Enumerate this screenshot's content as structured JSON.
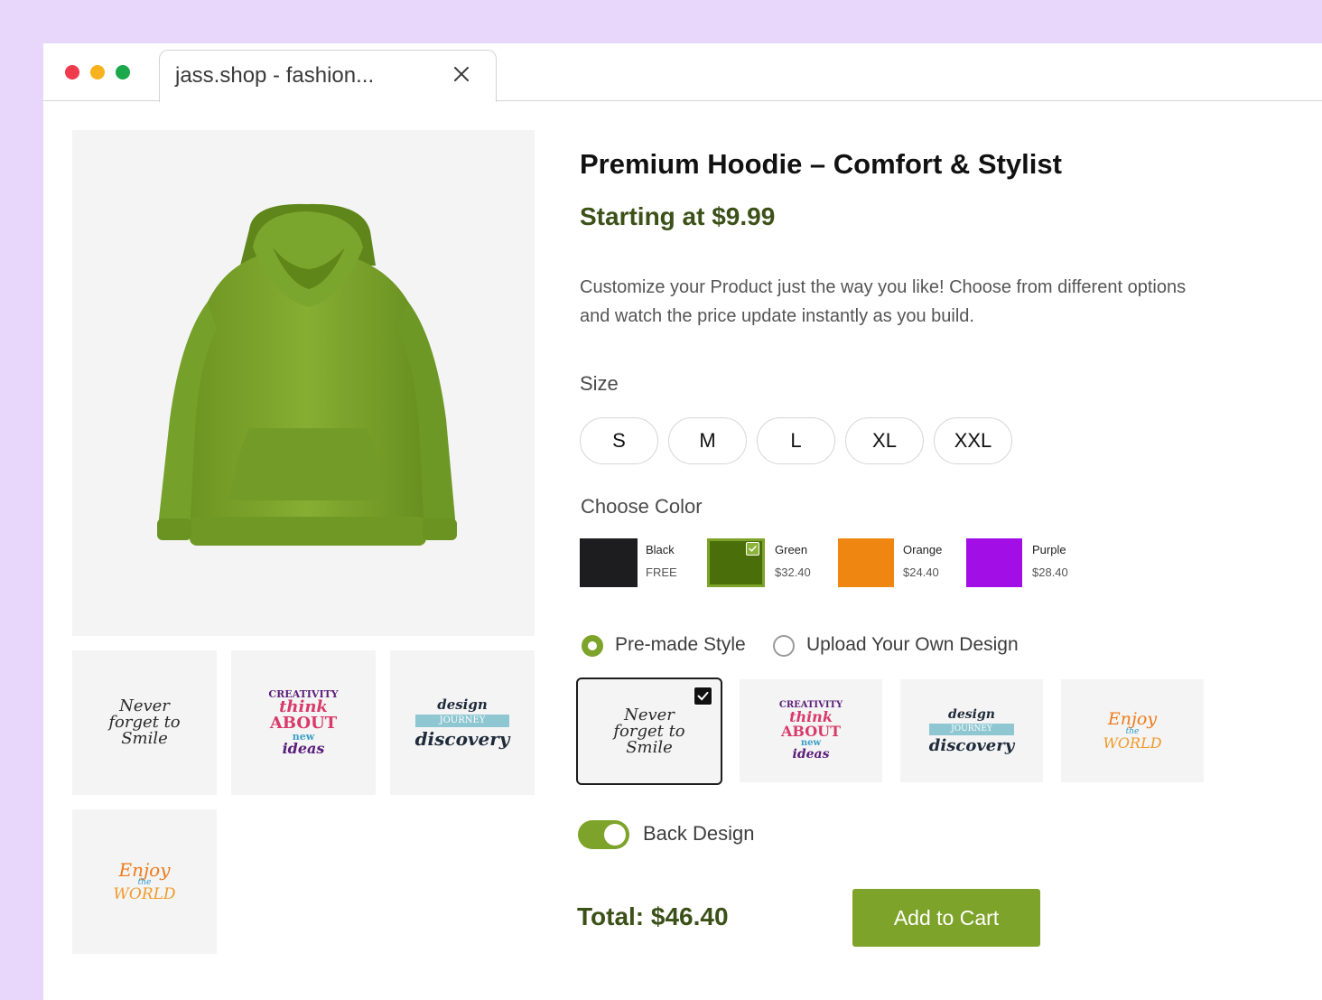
{
  "browser": {
    "tab_title": "jass.shop - fashion...",
    "icons": {
      "close": "close-icon"
    },
    "window_dots": [
      "#ef3b4c",
      "#f7b21e",
      "#1aa84a"
    ]
  },
  "product": {
    "title": "Premium Hoodie – Comfort & Stylist",
    "price": "Starting at $9.99",
    "description": "Customize your Product just the way you like! Choose from different options and watch the price update instantly as you build.",
    "image_color": "#7fa62c"
  },
  "size": {
    "label": "Size",
    "options": [
      "S",
      "M",
      "L",
      "XL",
      "XXL"
    ]
  },
  "color": {
    "label": "Choose Color",
    "selected": "Green",
    "options": [
      {
        "name": "Black",
        "price": "FREE",
        "hex": "#1d1d1f"
      },
      {
        "name": "Green",
        "price": "$32.40",
        "hex": "#4a6e09"
      },
      {
        "name": "Orange",
        "price": "$24.40",
        "hex": "#ef8612"
      },
      {
        "name": "Purple",
        "price": "$28.40",
        "hex": "#a20ee6"
      }
    ]
  },
  "style": {
    "options": [
      "Pre-made Style",
      "Upload Your Own Design"
    ],
    "selected": "Pre-made Style",
    "designs": [
      {
        "lines": [
          "Never",
          "forget to",
          "Smile"
        ]
      },
      {
        "lines": [
          "CREATIVITY",
          "think",
          "ABOUT",
          "new",
          "ideas"
        ]
      },
      {
        "lines": [
          "design",
          "JOURNEY",
          "discovery"
        ]
      },
      {
        "lines": [
          "Enjoy",
          "the",
          "WORLD"
        ]
      }
    ]
  },
  "back_design": {
    "label": "Back Design",
    "enabled": true
  },
  "cart": {
    "total": "Total: $46.40",
    "button": "Add to Cart"
  }
}
